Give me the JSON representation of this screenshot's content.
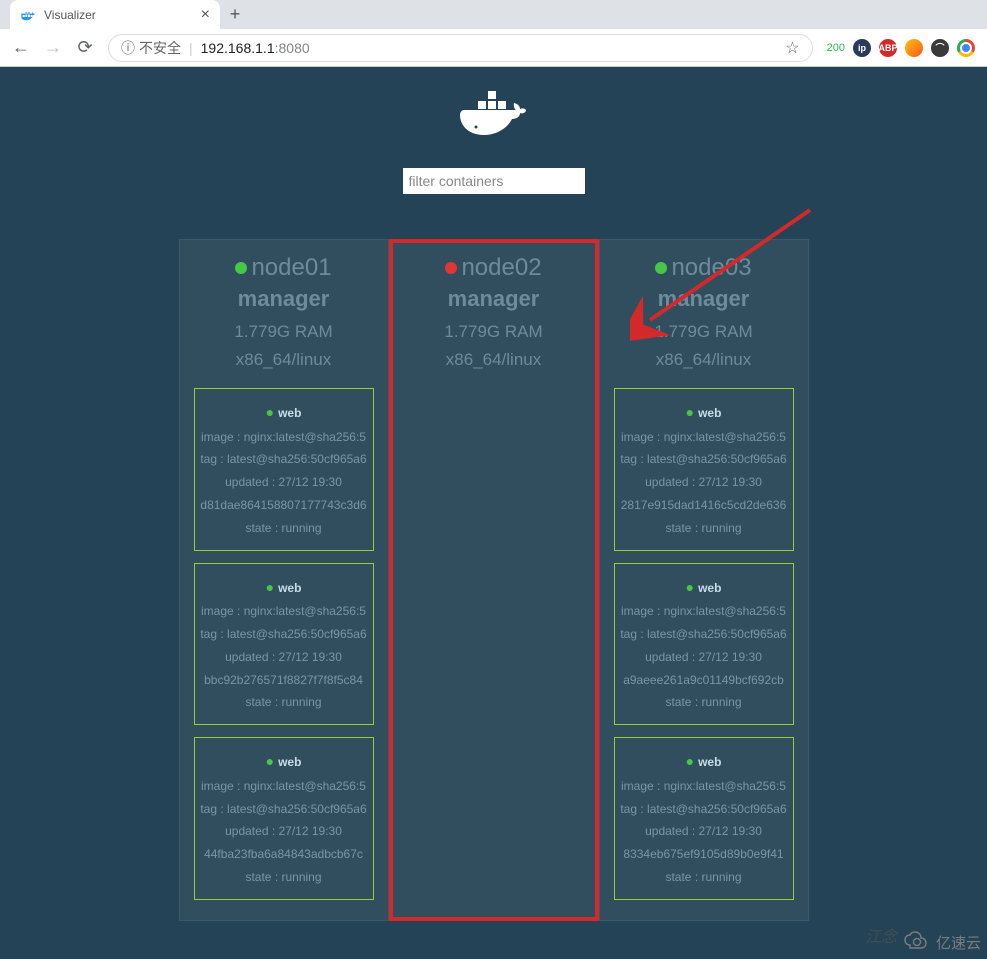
{
  "browser": {
    "tab_title": "Visualizer",
    "url_insecure_label": "不安全",
    "url_host": "192.168.1.1",
    "url_port": ":8080",
    "ext_badge": "200"
  },
  "filter": {
    "placeholder": "filter containers"
  },
  "nodes": [
    {
      "name": "node01",
      "status": "green",
      "role": "manager",
      "ram": "1.779G RAM",
      "arch": "x86_64/linux",
      "highlighted": false,
      "containers": [
        {
          "name": "web",
          "image": "image : nginx:latest@sha256:5",
          "tag": "tag : latest@sha256:50cf965a6",
          "updated": "updated : 27/12 19:30",
          "id": "d81dae864158807177743c3d6",
          "state": "state : running"
        },
        {
          "name": "web",
          "image": "image : nginx:latest@sha256:5",
          "tag": "tag : latest@sha256:50cf965a6",
          "updated": "updated : 27/12 19:30",
          "id": "bbc92b276571f8827f7f8f5c84",
          "state": "state : running"
        },
        {
          "name": "web",
          "image": "image : nginx:latest@sha256:5",
          "tag": "tag : latest@sha256:50cf965a6",
          "updated": "updated : 27/12 19:30",
          "id": "44fba23fba6a84843adbcb67c",
          "state": "state : running"
        }
      ]
    },
    {
      "name": "node02",
      "status": "red",
      "role": "manager",
      "ram": "1.779G RAM",
      "arch": "x86_64/linux",
      "highlighted": true,
      "containers": []
    },
    {
      "name": "node03",
      "status": "green",
      "role": "manager",
      "ram": "1.779G RAM",
      "arch": "x86_64/linux",
      "highlighted": false,
      "containers": [
        {
          "name": "web",
          "image": "image : nginx:latest@sha256:5",
          "tag": "tag : latest@sha256:50cf965a6",
          "updated": "updated : 27/12 19:30",
          "id": "2817e915dad1416c5cd2de636",
          "state": "state : running"
        },
        {
          "name": "web",
          "image": "image : nginx:latest@sha256:5",
          "tag": "tag : latest@sha256:50cf965a6",
          "updated": "updated : 27/12 19:30",
          "id": "a9aeee261a9c01149bcf692cb",
          "state": "state : running"
        },
        {
          "name": "web",
          "image": "image : nginx:latest@sha256:5",
          "tag": "tag : latest@sha256:50cf965a6",
          "updated": "updated : 27/12 19:30",
          "id": "8334eb675ef9105d89b0e9f41",
          "state": "state : running"
        }
      ]
    }
  ],
  "watermark": {
    "brand": "亿速云",
    "overlay": "江念"
  }
}
